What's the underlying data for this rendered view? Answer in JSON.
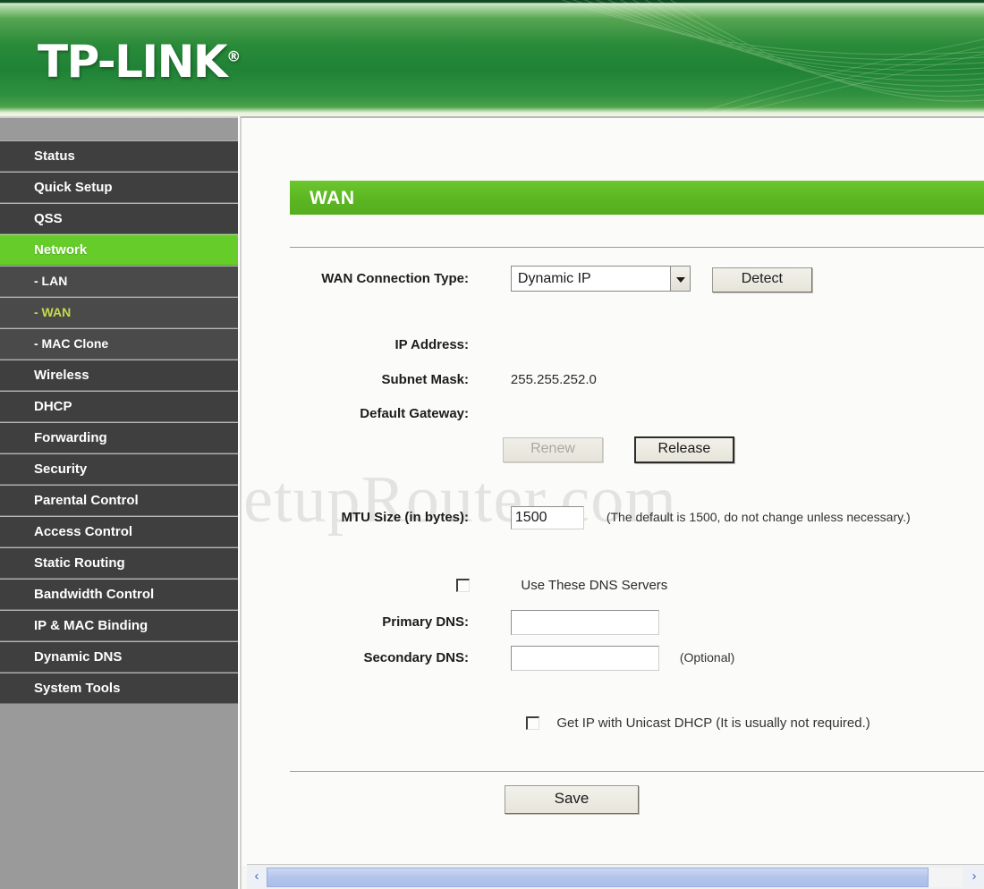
{
  "brand": {
    "name": "TP-LINK",
    "registered_mark": "®"
  },
  "sidebar": {
    "items": [
      {
        "label": "Status",
        "type": "main",
        "state": "normal"
      },
      {
        "label": "Quick Setup",
        "type": "main",
        "state": "normal"
      },
      {
        "label": "QSS",
        "type": "main",
        "state": "normal"
      },
      {
        "label": "Network",
        "type": "main",
        "state": "active"
      },
      {
        "label": "- LAN",
        "type": "sub",
        "state": "normal"
      },
      {
        "label": "- WAN",
        "type": "sub",
        "state": "current"
      },
      {
        "label": "- MAC Clone",
        "type": "sub",
        "state": "normal"
      },
      {
        "label": "Wireless",
        "type": "main",
        "state": "normal"
      },
      {
        "label": "DHCP",
        "type": "main",
        "state": "normal"
      },
      {
        "label": "Forwarding",
        "type": "main",
        "state": "normal"
      },
      {
        "label": "Security",
        "type": "main",
        "state": "normal"
      },
      {
        "label": "Parental Control",
        "type": "main",
        "state": "normal"
      },
      {
        "label": "Access Control",
        "type": "main",
        "state": "normal"
      },
      {
        "label": "Static Routing",
        "type": "main",
        "state": "normal"
      },
      {
        "label": "Bandwidth Control",
        "type": "main",
        "state": "normal"
      },
      {
        "label": "IP & MAC Binding",
        "type": "main",
        "state": "normal"
      },
      {
        "label": "Dynamic DNS",
        "type": "main",
        "state": "normal"
      },
      {
        "label": "System Tools",
        "type": "main",
        "state": "normal"
      }
    ]
  },
  "page": {
    "title": "WAN",
    "watermark": "SetupRouter.com",
    "connection_type": {
      "label": "WAN Connection Type:",
      "value": "Dynamic IP",
      "detect_button": "Detect"
    },
    "ip_address": {
      "label": "IP Address:",
      "value": ""
    },
    "subnet_mask": {
      "label": "Subnet Mask:",
      "value": "255.255.252.0"
    },
    "default_gateway": {
      "label": "Default Gateway:",
      "value": ""
    },
    "renew_button": {
      "label": "Renew",
      "disabled": true
    },
    "release_button": {
      "label": "Release",
      "disabled": false
    },
    "mtu": {
      "label": "MTU Size (in bytes):",
      "value": "1500",
      "hint": "(The default is 1500, do not change unless necessary.)"
    },
    "dns": {
      "use_these_label": "Use These DNS Servers",
      "use_these_checked": false,
      "primary": {
        "label": "Primary DNS:",
        "value": ""
      },
      "secondary": {
        "label": "Secondary DNS:",
        "value": "",
        "suffix": "(Optional)"
      }
    },
    "unicast_dhcp": {
      "label": "Get IP with Unicast DHCP (It is usually not required.)",
      "checked": false
    },
    "save_button": "Save"
  },
  "scrollbar": {
    "left_arrow": "‹",
    "right_arrow": "›"
  },
  "colors": {
    "brand_green": "#2a8b3a",
    "accent_green": "#66cc2a",
    "sidebar_item": "#3f3f3f",
    "current_sub": "#c8d94a"
  }
}
